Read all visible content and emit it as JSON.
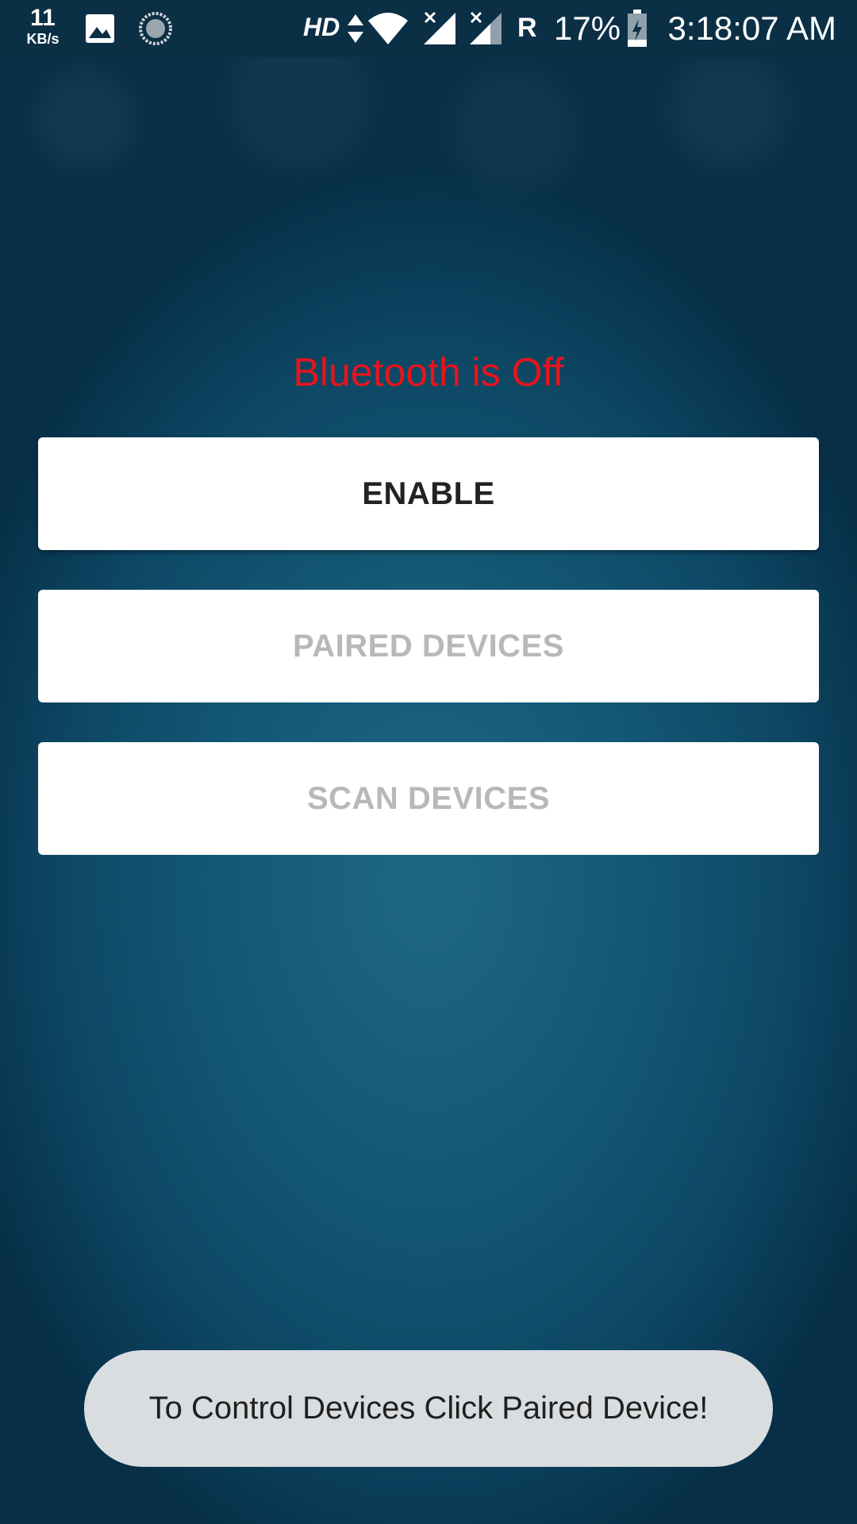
{
  "status_bar": {
    "net_speed_value": "11",
    "net_speed_unit": "KB/s",
    "network_type": "HD",
    "roaming": "R",
    "battery_percent": "17%",
    "time": "3:18:07 AM",
    "icons": [
      "image-notification-icon",
      "sync-icon",
      "data-arrows-icon",
      "wifi-icon",
      "signal-x-icon",
      "signal-x-icon",
      "battery-charging-icon"
    ]
  },
  "main": {
    "bluetooth_status": "Bluetooth is Off",
    "bluetooth_status_color": "#e8141c",
    "buttons": [
      {
        "label": "ENABLE",
        "enabled": true
      },
      {
        "label": "PAIRED DEVICES",
        "enabled": false
      },
      {
        "label": "SCAN DEVICES",
        "enabled": false
      }
    ]
  },
  "toast": {
    "message": "To Control Devices Click Paired Device!"
  }
}
